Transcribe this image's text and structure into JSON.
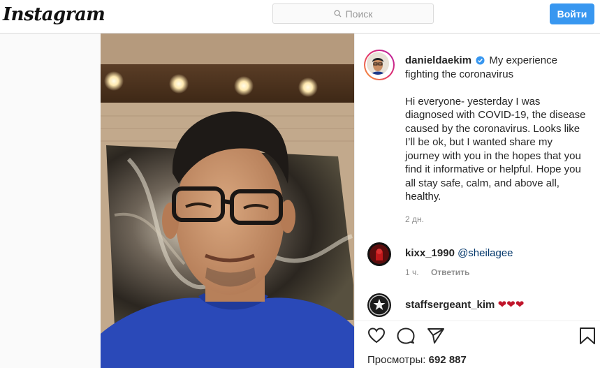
{
  "header": {
    "logo_text": "Instagram",
    "search_placeholder": "Поиск",
    "login_label": "Войти"
  },
  "post": {
    "author": "danieldaekim",
    "title": "My experience fighting the coronavirus",
    "body": "Hi everyone- yesterday I was diagnosed with COVID-19, the disease caused by the coronavirus. Looks like I’ll be ok, but I wanted share my journey with you in the hopes that you find it informative or helpful. Hope you all stay safe, calm, and above all, healthy.",
    "time_ago": "2 дн."
  },
  "comments": [
    {
      "user": "kixx_1990",
      "text": "@sheilagee",
      "time": "1 ч.",
      "reply_label": "Ответить"
    },
    {
      "user": "staffsergeant_kim",
      "text": "❤❤❤"
    }
  ],
  "stats": {
    "views_label": "Просмотры:",
    "views_value": "692 887"
  },
  "colors": {
    "accent": "#3897f0",
    "like_heart": "#ed4956"
  },
  "icons": [
    "search-icon",
    "verified-badge-icon",
    "heart-icon",
    "comment-icon",
    "share-icon",
    "bookmark-icon"
  ]
}
